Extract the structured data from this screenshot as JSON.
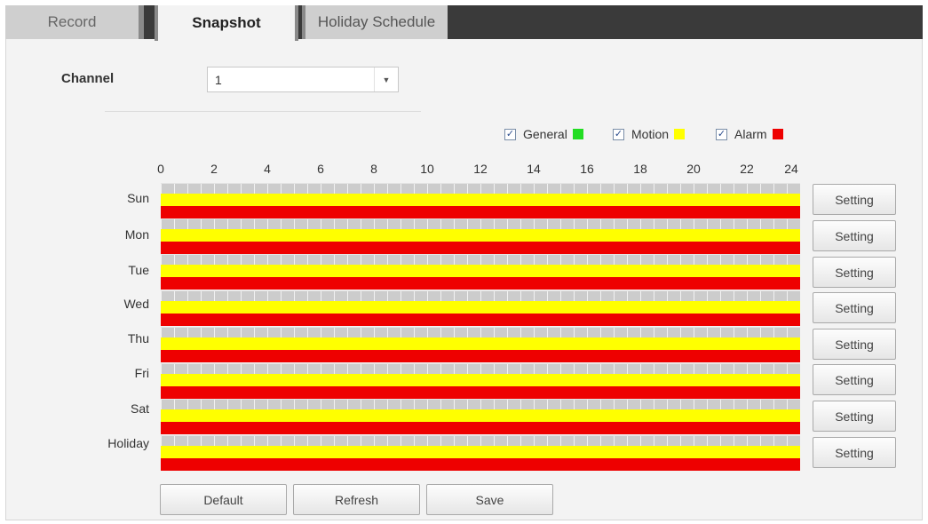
{
  "tabs": [
    {
      "label": "Record",
      "active": false
    },
    {
      "label": "Snapshot",
      "active": true
    },
    {
      "label": "Holiday Schedule",
      "active": false
    }
  ],
  "channel": {
    "label": "Channel",
    "selected": "1"
  },
  "legend": [
    {
      "label": "General",
      "checked": true,
      "color": "#22dd22"
    },
    {
      "label": "Motion",
      "checked": true,
      "color": "#ffff00"
    },
    {
      "label": "Alarm",
      "checked": true,
      "color": "#ee0000"
    }
  ],
  "hours": [
    "0",
    "2",
    "4",
    "6",
    "8",
    "10",
    "12",
    "14",
    "16",
    "18",
    "20",
    "22",
    "24"
  ],
  "days": [
    {
      "label": "Sun",
      "setting_label": "Setting",
      "general": false,
      "motion": true,
      "alarm": true
    },
    {
      "label": "Mon",
      "setting_label": "Setting",
      "general": false,
      "motion": true,
      "alarm": true
    },
    {
      "label": "Tue",
      "setting_label": "Setting",
      "general": false,
      "motion": true,
      "alarm": true
    },
    {
      "label": "Wed",
      "setting_label": "Setting",
      "general": false,
      "motion": true,
      "alarm": true
    },
    {
      "label": "Thu",
      "setting_label": "Setting",
      "general": false,
      "motion": true,
      "alarm": true
    },
    {
      "label": "Fri",
      "setting_label": "Setting",
      "general": false,
      "motion": true,
      "alarm": true
    },
    {
      "label": "Sat",
      "setting_label": "Setting",
      "general": false,
      "motion": true,
      "alarm": true
    },
    {
      "label": "Holiday",
      "setting_label": "Setting",
      "general": false,
      "motion": true,
      "alarm": true
    }
  ],
  "actions": {
    "default_label": "Default",
    "refresh_label": "Refresh",
    "save_label": "Save"
  }
}
